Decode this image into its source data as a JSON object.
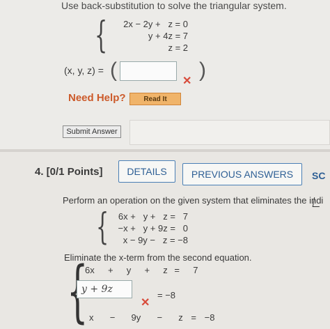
{
  "prev_question": {
    "prompt": "Use back-substitution to solve the triangular system.",
    "system": [
      "2x − 2y +   z = 0",
      "y + 4z = 7",
      "z = 2"
    ],
    "answer_label": "(x, y, z) =",
    "answer_value": "",
    "need_help": "Need Help?",
    "read_it": "Read It",
    "submit": "Submit Answer"
  },
  "question": {
    "number": "4.  [0/1 Points]",
    "tab_details": "DETAILS",
    "tab_previous": "PREVIOUS ANSWERS",
    "tab_more": "SC",
    "instruction": "Perform an operation on the given system that eliminates the indi",
    "system": [
      "6x +   y +   z =   7",
      "−x +   y + 9z =   0",
      "x − 9y −   z = −8"
    ],
    "elim_prompt": "Eliminate the x-term from the second equation.",
    "eq1": "6x  +  y  +  z =  7",
    "eq2_input": "y + 9z",
    "eq2_rhs": "= −8",
    "eq3": "x  −  9y  −  z = −8"
  }
}
